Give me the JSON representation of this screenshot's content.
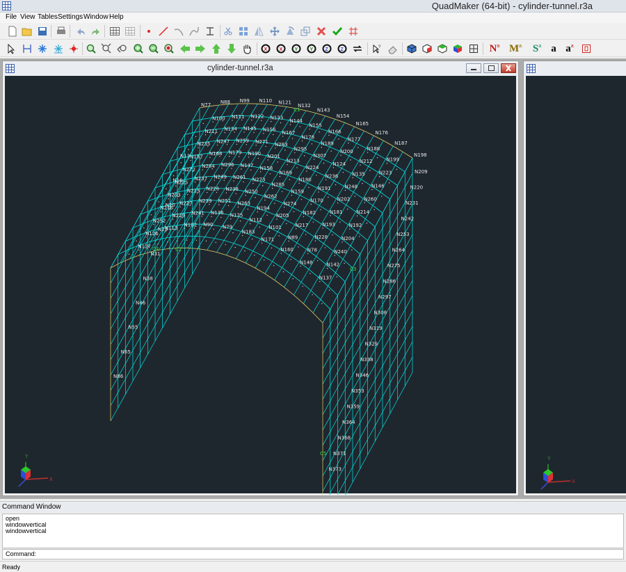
{
  "window": {
    "title": "QuadMaker (64-bit) - cylinder-tunnel.r3a"
  },
  "menu": [
    "File",
    "View",
    "Tables",
    "Settings",
    "Window",
    "Help"
  ],
  "toolbar1": [
    "new-file",
    "open-folder",
    "save",
    "print",
    "undo",
    "redo",
    "grid-table",
    "grid-table-2",
    "draw-node",
    "draw-line",
    "draw-arc",
    "draw-curve",
    "draw-beam",
    "cut",
    "array",
    "mirror",
    "move",
    "rotate",
    "scale",
    "delete-x",
    "check",
    "hash-grid"
  ],
  "toolbar2": [
    "select-arrow",
    "dimension",
    "snap-star",
    "snap-star-2",
    "snap-gear",
    "zoom-window",
    "zoom-fit",
    "zoom-pan-back",
    "zoom-in",
    "zoom-out",
    "zoom-reset",
    "arrow-left",
    "arrow-right",
    "arrow-up",
    "arrow-down",
    "pan-hand",
    "rotate-x",
    "rotate-x-neg",
    "rotate-y",
    "rotate-y-neg",
    "rotate-z",
    "rotate-z-neg",
    "swap",
    "select-help",
    "eraser",
    "view-iso-1",
    "view-iso-2",
    "view-iso-3",
    "view-color",
    "view-grid",
    "label-n",
    "label-m",
    "label-s",
    "font-a",
    "font-a2",
    "stop"
  ],
  "toolbar2_text": {
    "n": "N",
    "m": "M",
    "s": "S",
    "a1": "a",
    "a2": "a",
    "sup": "a"
  },
  "child1": {
    "title": "cylinder-tunnel.r3a"
  },
  "nodes_front_arc": [
    "N77",
    "N88",
    "N99",
    "N110",
    "N121",
    "N132",
    "N143",
    "N154",
    "N165",
    "N176",
    "N187",
    "N198"
  ],
  "nodes_right_column": [
    "N209",
    "N220",
    "N231",
    "N242",
    "N253",
    "N264",
    "N275",
    "N286",
    "N297",
    "N308",
    "N319",
    "N329",
    "N338",
    "N346",
    "N353",
    "N359",
    "N364",
    "N368",
    "N371",
    "N373"
  ],
  "nodes_left_column": [
    "N13",
    "N16",
    "N20",
    "N25",
    "N31",
    "N38",
    "N46",
    "N55",
    "N65",
    "N86"
  ],
  "nodes_inner": [
    "N100",
    "N111",
    "N122",
    "N133",
    "N144",
    "N155",
    "N166",
    "N177",
    "N188",
    "N199",
    "N211",
    "N134",
    "N145",
    "N156",
    "N167",
    "N178",
    "N189",
    "N200",
    "N212",
    "N223",
    "N235",
    "N247",
    "N259",
    "N271",
    "N283",
    "N295",
    "N307",
    "N124",
    "N135",
    "N146",
    "N157",
    "N168",
    "N179",
    "N190",
    "N201",
    "N213",
    "N224",
    "N236",
    "N248",
    "N260",
    "N272",
    "N284",
    "N296",
    "N147",
    "N158",
    "N169",
    "N180",
    "N191",
    "N202",
    "N214",
    "N225",
    "N237",
    "N249",
    "N261",
    "N273",
    "N285",
    "N159",
    "N170",
    "N181",
    "N192",
    "N203",
    "N215",
    "N226",
    "N238",
    "N250",
    "N262",
    "N274",
    "N182",
    "N193",
    "N204",
    "N216",
    "N227",
    "N239",
    "N251",
    "N263",
    "N194",
    "N205",
    "N217",
    "N228",
    "N240",
    "N252",
    "N229",
    "N241",
    "N136",
    "N125",
    "N112",
    "N101",
    "N89",
    "N78",
    "N142",
    "N126",
    "N113",
    "N102",
    "N90",
    "N79",
    "N183",
    "N171",
    "N160",
    "N148",
    "N137",
    "N127"
  ],
  "green_labels": [
    "C1",
    "C2",
    "C3",
    "C4",
    "C5"
  ],
  "command_window": {
    "title": "Command Window",
    "lines": [
      "open",
      "windowvertical",
      "windowvertical"
    ],
    "prompt": "Command:"
  },
  "status": "Ready",
  "axis_labels": {
    "x": "X",
    "y": "Y"
  },
  "colors": {
    "canvas": "#1f272e",
    "mesh": "#00e5e5",
    "edge": "#e8cf66",
    "label": "#e6e6e6",
    "green": "#3ddc3d"
  }
}
